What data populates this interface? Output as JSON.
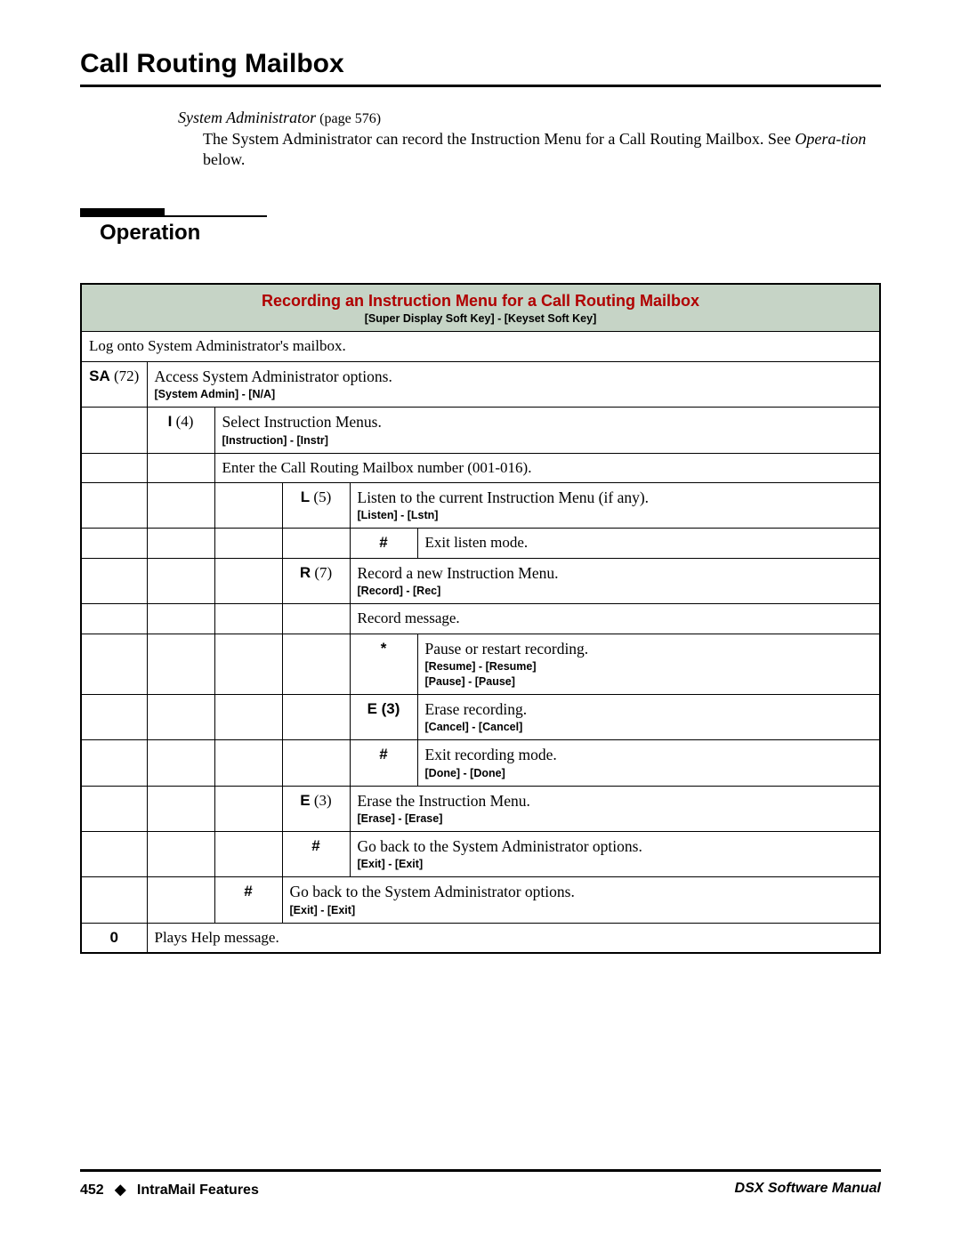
{
  "page_title": "Call Routing Mailbox",
  "intro": {
    "heading": "System Administrator",
    "page_ref": " (page 576)",
    "body_pre": "The System Administrator can record the Instruction Menu for a Call Routing Mailbox. See ",
    "body_em": "Opera-tion",
    "body_post": " below."
  },
  "section_heading": "Operation",
  "table_header": {
    "title": "Recording an Instruction Menu for a Call Routing Mailbox",
    "sub": "[Super Display Soft Key] - [Keyset Soft Key]"
  },
  "rows": {
    "logon": "Log onto System Administrator's mailbox.",
    "sa_key": "SA",
    "sa_paren": " (72)",
    "sa_desc": "Access System Administrator options.",
    "sa_soft": "[System Admin] - [N/A]",
    "i_key": "I",
    "i_paren": " (4)",
    "i_desc": "Select Instruction Menus.",
    "i_soft": "[Instruction] - [Instr]",
    "enter_crm": "Enter the Call Routing Mailbox number (001-016).",
    "l_key": "L",
    "l_paren": " (5)",
    "l_desc": "Listen to the current Instruction Menu (if any).",
    "l_soft": "[Listen] - [Lstn]",
    "hash1_key": "#",
    "hash1_desc": "Exit listen mode.",
    "r_key": "R",
    "r_paren": " (7)",
    "r_desc": "Record a new Instruction Menu.",
    "r_soft": "[Record] - [Rec]",
    "record_msg": "Record message.",
    "star_key": "*",
    "star_desc": "Pause or restart recording.",
    "star_soft1": "[Resume] - [Resume]",
    "star_soft2": "[Pause] - [Pause]",
    "e3a_key": "E (3)",
    "e3a_desc": "Erase recording.",
    "e3a_soft": "[Cancel] - [Cancel]",
    "hash2_key": "#",
    "hash2_desc": "Exit recording mode.",
    "hash2_soft": "[Done] - [Done]",
    "e3b_key": "E",
    "e3b_paren": " (3)",
    "e3b_desc": "Erase the Instruction Menu.",
    "e3b_soft": "[Erase] - [Erase]",
    "hash3_key": "#",
    "hash3_desc": "Go back to the System Administrator options.",
    "hash3_soft": "[Exit] - [Exit]",
    "hash4_key": "#",
    "hash4_desc": "Go back to the System Administrator options.",
    "hash4_soft": "[Exit] - [Exit]",
    "zero_key": "0",
    "zero_desc": "Plays Help message."
  },
  "footer": {
    "page_num": "452",
    "section": "IntraMail Features",
    "manual": "DSX Software Manual"
  }
}
